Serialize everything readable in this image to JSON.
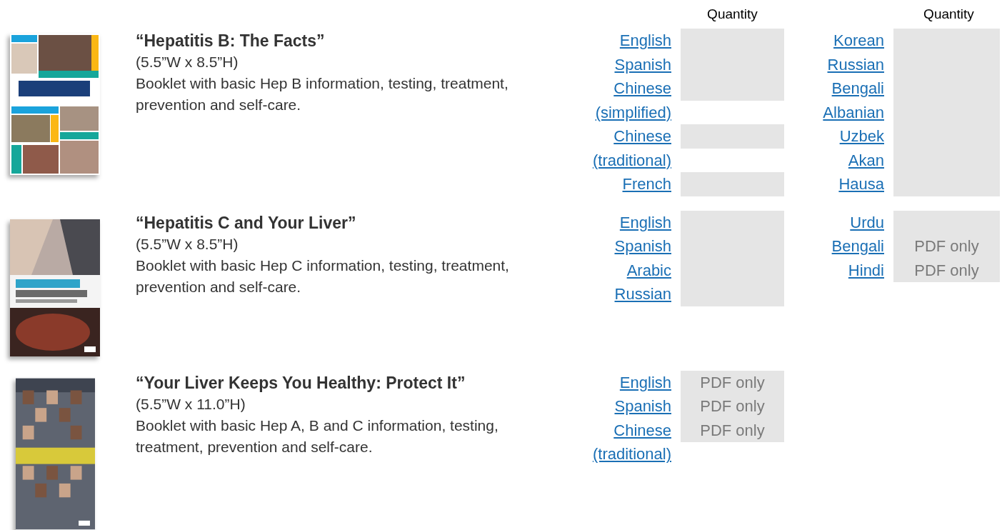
{
  "quantity_headers": [
    "Quantity",
    "Quantity"
  ],
  "booklets": [
    {
      "cover": {
        "kind": "picture"
      },
      "title": "“Hepatitis B: The Facts”",
      "size": "(5.5”W x 8.5”H)",
      "description": "Booklet with basic Hep B information, testing, treatment, prevention and self-care.",
      "columns": [
        [
          {
            "language": "English",
            "kind": "field"
          },
          {
            "language": "Spanish",
            "kind": "field"
          },
          {
            "language": "Chinese (simplified)",
            "kind": "field"
          },
          {
            "language": "Chinese (traditional)",
            "kind": "field"
          },
          {
            "language": "French",
            "kind": "field"
          }
        ],
        [
          {
            "language": "Korean",
            "kind": "field"
          },
          {
            "language": "Russian",
            "kind": "field"
          },
          {
            "language": "Bengali",
            "kind": "field"
          },
          {
            "language": "Albanian",
            "kind": "field"
          },
          {
            "language": "Uzbek",
            "kind": "field"
          },
          {
            "language": "Akan",
            "kind": "field"
          },
          {
            "language": "Hausa",
            "kind": "field"
          }
        ]
      ]
    },
    {
      "cover": {
        "kind": "picture"
      },
      "title": "“Hepatitis C and Your Liver”",
      "size": "(5.5”W x 8.5”H)",
      "description": "Booklet with basic Hep C information, testing, treatment, prevention and self-care.",
      "columns": [
        [
          {
            "language": "English",
            "kind": "field"
          },
          {
            "language": "Spanish",
            "kind": "field"
          },
          {
            "language": "Arabic",
            "kind": "field"
          },
          {
            "language": "Russian",
            "kind": "field"
          }
        ],
        [
          {
            "language": "Urdu",
            "kind": "field"
          },
          {
            "language": "Bengali",
            "kind": "pdf",
            "note": "PDF only"
          },
          {
            "language": "Hindi",
            "kind": "pdf",
            "note": "PDF only"
          }
        ]
      ]
    },
    {
      "cover": {
        "kind": "picture"
      },
      "title": "“Your Liver Keeps You Healthy: Protect It”",
      "size": "(5.5”W x 11.0”H)",
      "description": "Booklet with basic Hep A, B and C information, testing, treatment, prevention and self-care.",
      "columns": [
        [
          {
            "language": "English",
            "kind": "pdf",
            "note": "PDF only"
          },
          {
            "language": "Spanish",
            "kind": "pdf",
            "note": "PDF only"
          },
          {
            "language": "Chinese (traditional)",
            "kind": "pdf",
            "note": "PDF only"
          }
        ]
      ]
    }
  ]
}
